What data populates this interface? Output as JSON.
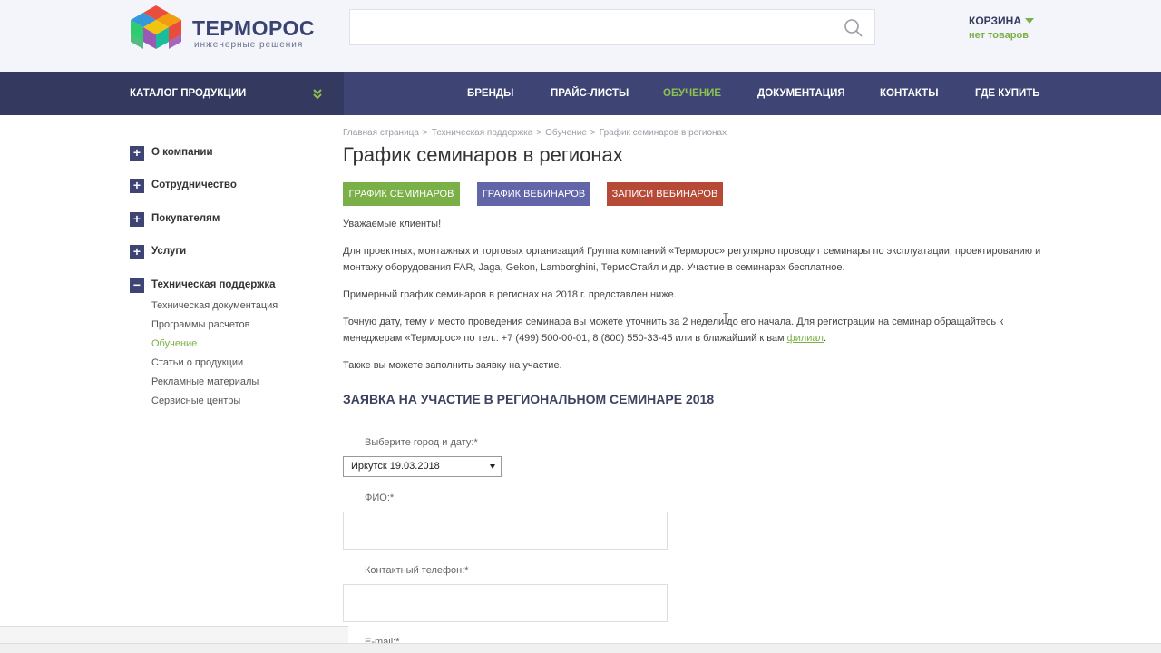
{
  "header": {
    "logo_name": "ТЕРМОРОС",
    "logo_sub": "инженерные решения",
    "search_placeholder": "",
    "cart_title": "КОРЗИНА",
    "cart_status": "нет товаров"
  },
  "nav": {
    "catalog": "КАТАЛОГ ПРОДУКЦИИ",
    "items": [
      "БРЕНДЫ",
      "ПРАЙС-ЛИСТЫ",
      "ОБУЧЕНИЕ",
      "ДОКУМЕНТАЦИЯ",
      "КОНТАКТЫ",
      "ГДЕ КУПИТЬ"
    ],
    "active": "ОБУЧЕНИЕ"
  },
  "sidebar": {
    "items": [
      "О компании",
      "Сотрудничество",
      "Покупателям",
      "Услуги",
      "Техническая поддержка"
    ],
    "subitems": [
      "Техническая документация",
      "Программы расчетов",
      "Обучение",
      "Статьи о продукции",
      "Рекламные материалы",
      "Сервисные центры"
    ]
  },
  "breadcrumb": [
    "Главная страница",
    "Техническая поддержка",
    "Обучение",
    "График семинаров в регионах"
  ],
  "page": {
    "title": "График семинаров в регионах",
    "btn_seminars": "ГРАФИК СЕМИНАРОВ",
    "btn_webinars": "ГРАФИК ВЕБИНАРОВ",
    "btn_records": "ЗАПИСИ ВЕБИНАРОВ",
    "p1": "Уважаемые клиенты!",
    "p2": "Для проектных, монтажных и торговых организаций Группа компаний «Терморос» регулярно проводит семинары по эксплуатации, проектированию и монтажу оборудования FAR, Jaga, Gekon, Lamborghini, ТермоСтайл и др. Участие в семинарах бесплатное.",
    "p3": "Примерный график семинаров в регионах на 2018 г. представлен ниже.",
    "p4a": "Точную дату, тему и место проведения семинара вы можете уточнить за 2 недели до его начала. Для регистрации на семинар обращайтесь к менеджерам «Терморос» по тел.: +7 (499) 500-00-01, 8 (800) 550-33-45 или в ближайший к вам ",
    "p4link": "филиал",
    "p4b": ".",
    "p5": "Также вы можете заполнить заявку на участие.",
    "section_title": "ЗАЯВКА НА УЧАСТИЕ В РЕГИОНАЛЬНОМ СЕМИНАРЕ 2018"
  },
  "form": {
    "city_label": "Выберите город и дату:*",
    "city_value": "Иркутск 19.03.2018",
    "name_label": "ФИО:*",
    "phone_label": "Контактный телефон:*",
    "email_label": "E-mail:*"
  },
  "colors": {
    "nav_bg": "#3e4575",
    "accent_green": "#7ab047",
    "btn_purple": "#6266a8",
    "btn_red": "#b64a37"
  }
}
